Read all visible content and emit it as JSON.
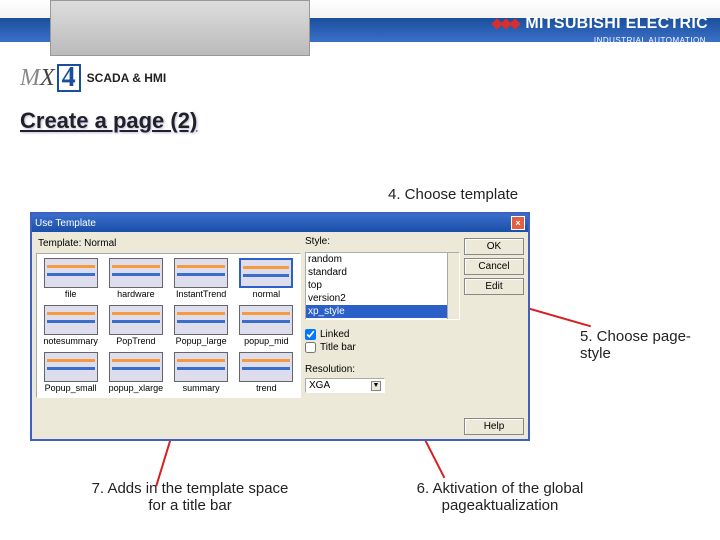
{
  "brand": {
    "name": "MITSUBISHI ELECTRIC",
    "sub": "INDUSTRIAL AUTOMATION"
  },
  "product": {
    "m": "M",
    "x": "X",
    "four": "4",
    "tagline": "SCADA & HMI"
  },
  "slide_title": "Create a page (2)",
  "notes": {
    "n4": "4. Choose template",
    "n5": "5. Choose page-style",
    "n6": "6. Aktivation of the global pageaktualization",
    "n7": "7. Adds in the template space for a title bar"
  },
  "dialog": {
    "title": "Use Template",
    "template_label": "Template: Normal",
    "templates": [
      "file",
      "hardware",
      "InstantTrend",
      "normal",
      "notesummary",
      "PopTrend",
      "Popup_large",
      "popup_mid",
      "Popup_small",
      "popup_xlarge",
      "summary",
      "trend"
    ],
    "selected_template_index": 3,
    "style_label": "Style:",
    "styles": [
      "random",
      "standard",
      "top",
      "version2",
      "xp_style"
    ],
    "selected_style_index": 4,
    "check_linked": "Linked",
    "check_titlebar": "Title bar",
    "linked_checked": true,
    "titlebar_checked": false,
    "resolution_label": "Resolution:",
    "resolution_value": "XGA",
    "buttons": {
      "ok": "OK",
      "cancel": "Cancel",
      "edit": "Edit",
      "help": "Help"
    }
  }
}
